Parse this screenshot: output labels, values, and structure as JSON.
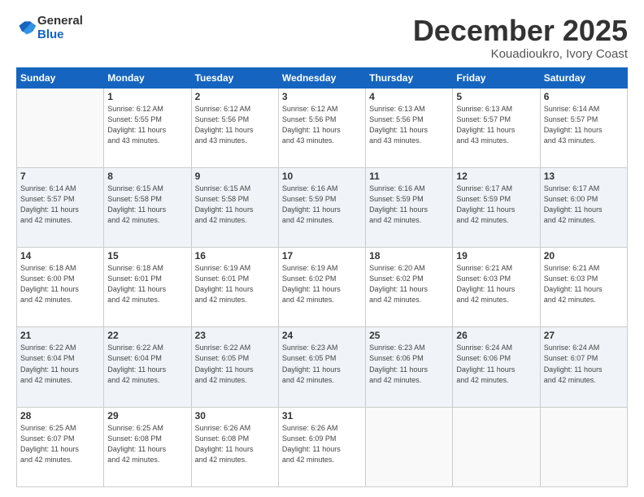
{
  "header": {
    "logo_general": "General",
    "logo_blue": "Blue",
    "title": "December 2025",
    "subtitle": "Kouadioukro, Ivory Coast"
  },
  "days_of_week": [
    "Sunday",
    "Monday",
    "Tuesday",
    "Wednesday",
    "Thursday",
    "Friday",
    "Saturday"
  ],
  "weeks": [
    [
      {
        "day": "",
        "info": ""
      },
      {
        "day": "1",
        "info": "Sunrise: 6:12 AM\nSunset: 5:55 PM\nDaylight: 11 hours\nand 43 minutes."
      },
      {
        "day": "2",
        "info": "Sunrise: 6:12 AM\nSunset: 5:56 PM\nDaylight: 11 hours\nand 43 minutes."
      },
      {
        "day": "3",
        "info": "Sunrise: 6:12 AM\nSunset: 5:56 PM\nDaylight: 11 hours\nand 43 minutes."
      },
      {
        "day": "4",
        "info": "Sunrise: 6:13 AM\nSunset: 5:56 PM\nDaylight: 11 hours\nand 43 minutes."
      },
      {
        "day": "5",
        "info": "Sunrise: 6:13 AM\nSunset: 5:57 PM\nDaylight: 11 hours\nand 43 minutes."
      },
      {
        "day": "6",
        "info": "Sunrise: 6:14 AM\nSunset: 5:57 PM\nDaylight: 11 hours\nand 43 minutes."
      }
    ],
    [
      {
        "day": "7",
        "info": "Sunrise: 6:14 AM\nSunset: 5:57 PM\nDaylight: 11 hours\nand 42 minutes."
      },
      {
        "day": "8",
        "info": "Sunrise: 6:15 AM\nSunset: 5:58 PM\nDaylight: 11 hours\nand 42 minutes."
      },
      {
        "day": "9",
        "info": "Sunrise: 6:15 AM\nSunset: 5:58 PM\nDaylight: 11 hours\nand 42 minutes."
      },
      {
        "day": "10",
        "info": "Sunrise: 6:16 AM\nSunset: 5:59 PM\nDaylight: 11 hours\nand 42 minutes."
      },
      {
        "day": "11",
        "info": "Sunrise: 6:16 AM\nSunset: 5:59 PM\nDaylight: 11 hours\nand 42 minutes."
      },
      {
        "day": "12",
        "info": "Sunrise: 6:17 AM\nSunset: 5:59 PM\nDaylight: 11 hours\nand 42 minutes."
      },
      {
        "day": "13",
        "info": "Sunrise: 6:17 AM\nSunset: 6:00 PM\nDaylight: 11 hours\nand 42 minutes."
      }
    ],
    [
      {
        "day": "14",
        "info": "Sunrise: 6:18 AM\nSunset: 6:00 PM\nDaylight: 11 hours\nand 42 minutes."
      },
      {
        "day": "15",
        "info": "Sunrise: 6:18 AM\nSunset: 6:01 PM\nDaylight: 11 hours\nand 42 minutes."
      },
      {
        "day": "16",
        "info": "Sunrise: 6:19 AM\nSunset: 6:01 PM\nDaylight: 11 hours\nand 42 minutes."
      },
      {
        "day": "17",
        "info": "Sunrise: 6:19 AM\nSunset: 6:02 PM\nDaylight: 11 hours\nand 42 minutes."
      },
      {
        "day": "18",
        "info": "Sunrise: 6:20 AM\nSunset: 6:02 PM\nDaylight: 11 hours\nand 42 minutes."
      },
      {
        "day": "19",
        "info": "Sunrise: 6:21 AM\nSunset: 6:03 PM\nDaylight: 11 hours\nand 42 minutes."
      },
      {
        "day": "20",
        "info": "Sunrise: 6:21 AM\nSunset: 6:03 PM\nDaylight: 11 hours\nand 42 minutes."
      }
    ],
    [
      {
        "day": "21",
        "info": "Sunrise: 6:22 AM\nSunset: 6:04 PM\nDaylight: 11 hours\nand 42 minutes."
      },
      {
        "day": "22",
        "info": "Sunrise: 6:22 AM\nSunset: 6:04 PM\nDaylight: 11 hours\nand 42 minutes."
      },
      {
        "day": "23",
        "info": "Sunrise: 6:22 AM\nSunset: 6:05 PM\nDaylight: 11 hours\nand 42 minutes."
      },
      {
        "day": "24",
        "info": "Sunrise: 6:23 AM\nSunset: 6:05 PM\nDaylight: 11 hours\nand 42 minutes."
      },
      {
        "day": "25",
        "info": "Sunrise: 6:23 AM\nSunset: 6:06 PM\nDaylight: 11 hours\nand 42 minutes."
      },
      {
        "day": "26",
        "info": "Sunrise: 6:24 AM\nSunset: 6:06 PM\nDaylight: 11 hours\nand 42 minutes."
      },
      {
        "day": "27",
        "info": "Sunrise: 6:24 AM\nSunset: 6:07 PM\nDaylight: 11 hours\nand 42 minutes."
      }
    ],
    [
      {
        "day": "28",
        "info": "Sunrise: 6:25 AM\nSunset: 6:07 PM\nDaylight: 11 hours\nand 42 minutes."
      },
      {
        "day": "29",
        "info": "Sunrise: 6:25 AM\nSunset: 6:08 PM\nDaylight: 11 hours\nand 42 minutes."
      },
      {
        "day": "30",
        "info": "Sunrise: 6:26 AM\nSunset: 6:08 PM\nDaylight: 11 hours\nand 42 minutes."
      },
      {
        "day": "31",
        "info": "Sunrise: 6:26 AM\nSunset: 6:09 PM\nDaylight: 11 hours\nand 42 minutes."
      },
      {
        "day": "",
        "info": ""
      },
      {
        "day": "",
        "info": ""
      },
      {
        "day": "",
        "info": ""
      }
    ]
  ]
}
